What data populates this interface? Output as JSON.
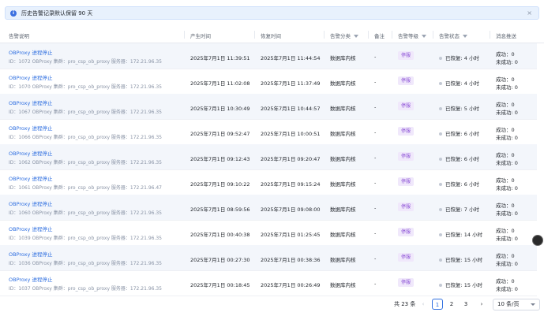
{
  "banner": {
    "text": "历史告警记录默认保留 90 天",
    "info_icon": "i",
    "close_glyph": "×"
  },
  "headers": {
    "desc": "告警说明",
    "created": "产生时间",
    "recovered": "恢复时间",
    "category": "告警分类",
    "note": "备注",
    "level": "告警等级",
    "status": "告警状态",
    "push": "消息推送"
  },
  "rows": [
    {
      "title": "OBProxy 进程停止",
      "detail": "ID：1072  OBProxy  集群：pro_csp_ob_proxy  服务器：172.21.96.35",
      "created": "2025年7月1日 11:39:51",
      "recovered": "2025年7月1日 11:44:54",
      "category": "数据库内核",
      "note": "-",
      "level": "停服",
      "status": "已恢复: 4 小时",
      "push_ok": "成功：0",
      "push_fail": "未成功: 0"
    },
    {
      "title": "OBProxy 进程停止",
      "detail": "ID：1070  OBProxy  集群：pro_csp_ob_proxy  服务器：172.21.96.35",
      "created": "2025年7月1日 11:02:08",
      "recovered": "2025年7月1日 11:37:49",
      "category": "数据库内核",
      "note": "-",
      "level": "停服",
      "status": "已恢复: 4 小时",
      "push_ok": "成功：0",
      "push_fail": "未成功: 0"
    },
    {
      "title": "OBProxy 进程停止",
      "detail": "ID：1067  OBProxy  集群：pro_csp_ob_proxy  服务器：172.21.96.35",
      "created": "2025年7月1日 10:30:49",
      "recovered": "2025年7月1日 10:44:57",
      "category": "数据库内核",
      "note": "-",
      "level": "停服",
      "status": "已恢复: 5 小时",
      "push_ok": "成功：0",
      "push_fail": "未成功: 0"
    },
    {
      "title": "OBProxy 进程停止",
      "detail": "ID：1066  OBProxy  集群：pro_csp_ob_proxy  服务器：172.21.96.35",
      "created": "2025年7月1日 09:52:47",
      "recovered": "2025年7月1日 10:00:51",
      "category": "数据库内核",
      "note": "-",
      "level": "停服",
      "status": "已恢复: 6 小时",
      "push_ok": "成功：0",
      "push_fail": "未成功: 0"
    },
    {
      "title": "OBProxy 进程停止",
      "detail": "ID：1062  OBProxy  集群：pro_csp_ob_proxy  服务器：172.21.96.35",
      "created": "2025年7月1日 09:12:43",
      "recovered": "2025年7月1日 09:20:47",
      "category": "数据库内核",
      "note": "-",
      "level": "停服",
      "status": "已恢复: 6 小时",
      "push_ok": "成功：0",
      "push_fail": "未成功: 0"
    },
    {
      "title": "OBProxy 进程停止",
      "detail": "ID：1061  OBProxy  集群：pro_csp_ob_proxy  服务器：172.21.96.47",
      "created": "2025年7月1日 09:10:22",
      "recovered": "2025年7月1日 09:15:24",
      "category": "数据库内核",
      "note": "-",
      "level": "停服",
      "status": "已恢复: 6 小时",
      "push_ok": "成功：0",
      "push_fail": "未成功: 0"
    },
    {
      "title": "OBProxy 进程停止",
      "detail": "ID：1060  OBProxy  集群：pro_csp_ob_proxy  服务器：172.21.96.35",
      "created": "2025年7月1日 08:59:56",
      "recovered": "2025年7月1日 09:08:00",
      "category": "数据库内核",
      "note": "-",
      "level": "停服",
      "status": "已恢复: 7 小时",
      "push_ok": "成功：0",
      "push_fail": "未成功: 0"
    },
    {
      "title": "OBProxy 进程停止",
      "detail": "ID：1039  OBProxy  集群：pro_csp_ob_proxy  服务器：172.21.96.35",
      "created": "2025年7月1日 00:40:38",
      "recovered": "2025年7月1日 01:25:45",
      "category": "数据库内核",
      "note": "-",
      "level": "停服",
      "status": "已恢复: 14 小时",
      "push_ok": "成功：0",
      "push_fail": "未成功: 0"
    },
    {
      "title": "OBProxy 进程停止",
      "detail": "ID：1036  OBProxy  集群：pro_csp_ob_proxy  服务器：172.21.96.35",
      "created": "2025年7月1日 00:27:30",
      "recovered": "2025年7月1日 00:38:36",
      "category": "数据库内核",
      "note": "-",
      "level": "停服",
      "status": "已恢复: 15 小时",
      "push_ok": "成功：0",
      "push_fail": "未成功: 0"
    },
    {
      "title": "OBProxy 进程停止",
      "detail": "ID：1037  OBProxy  集群：pro_csp_ob_proxy  服务器：172.21.96.35",
      "created": "2025年7月1日 00:18:45",
      "recovered": "2025年7月1日 00:26:49",
      "category": "数据库内核",
      "note": "-",
      "level": "停服",
      "status": "已恢复: 15 小时",
      "push_ok": "成功：0",
      "push_fail": "未成功: 0"
    }
  ],
  "pagination": {
    "total": "共 23 条",
    "prev": "‹",
    "next": "›",
    "pages": [
      "1",
      "2",
      "3"
    ],
    "current": "1",
    "page_size": "10 条/页"
  },
  "colors": {
    "link": "#2f6fe0",
    "badge_bg": "#f0e8fb",
    "badge_fg": "#8a4fd6",
    "alt_row": "#f3f6fb",
    "banner_bg": "#e8f1fd"
  }
}
